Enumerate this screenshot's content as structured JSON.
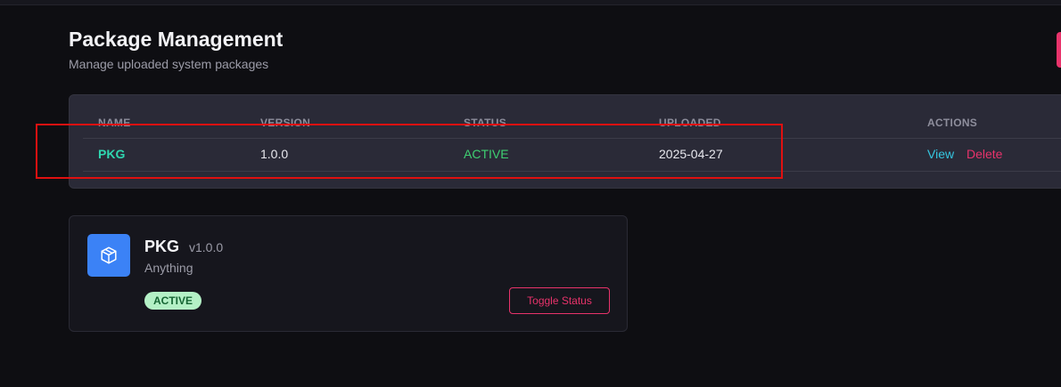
{
  "header": {
    "title": "Package Management",
    "subtitle": "Manage uploaded system packages"
  },
  "table": {
    "columns": [
      "NAME",
      "VERSION",
      "STATUS",
      "UPLOADED",
      "ACTIONS"
    ],
    "rows": [
      {
        "name": "PKG",
        "version": "1.0.0",
        "status": "ACTIVE",
        "uploaded": "2025-04-27",
        "actions": {
          "view": "View",
          "delete": "Delete"
        }
      }
    ]
  },
  "card": {
    "icon": "package-icon",
    "name": "PKG",
    "version": "v1.0.0",
    "description": "Anything",
    "status_badge": "ACTIVE",
    "toggle_label": "Toggle Status"
  },
  "colors": {
    "accent": "#e8336b",
    "name_teal": "#2fd6b0",
    "status_green": "#3fcf72",
    "view_cyan": "#35c6e0",
    "icon_blue": "#3b82f6",
    "highlight_red": "#e01010"
  }
}
